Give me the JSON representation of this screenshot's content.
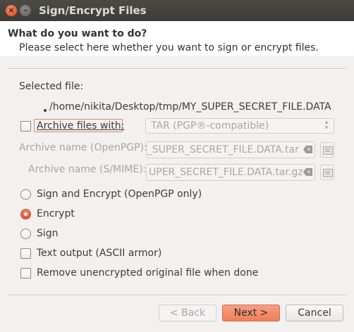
{
  "window": {
    "title": "Sign/Encrypt Files",
    "close_glyph": "×",
    "min_glyph": "–"
  },
  "header": {
    "title": "What do you want to do?",
    "subtitle": "Please select here whether you want to sign or encrypt files."
  },
  "selected_file": {
    "label": "Selected file:",
    "path": "/home/nikita/Desktop/tmp/MY_SUPER_SECRET_FILE.DATA"
  },
  "archive": {
    "checkbox_label": "Archive files with:",
    "checked": false,
    "format_value": "TAR (PGP®-compatible)",
    "openpgp_label": "Archive name (OpenPGP):",
    "openpgp_value": "/_SUPER_SECRET_FILE.DATA.tar",
    "smime_label": "Archive name (S/MIME):",
    "smime_value": "UPER_SECRET_FILE.DATA.tar.gz"
  },
  "options": {
    "sign_and_encrypt": "Sign and Encrypt (OpenPGP only)",
    "encrypt": "Encrypt",
    "sign": "Sign",
    "selected": "encrypt",
    "text_output": "Text output (ASCII armor)",
    "remove_original": "Remove unencrypted original file when done"
  },
  "buttons": {
    "back": "< Back",
    "next": "Next >",
    "cancel": "Cancel"
  },
  "icons": {
    "clear": "clear-entry-icon",
    "file": "file-chooser-icon",
    "combo_arrows": "⌃⌄"
  },
  "colors": {
    "accent": "#ef7e58",
    "titlebar": "#3d3c38",
    "background": "#f2f1f0"
  }
}
